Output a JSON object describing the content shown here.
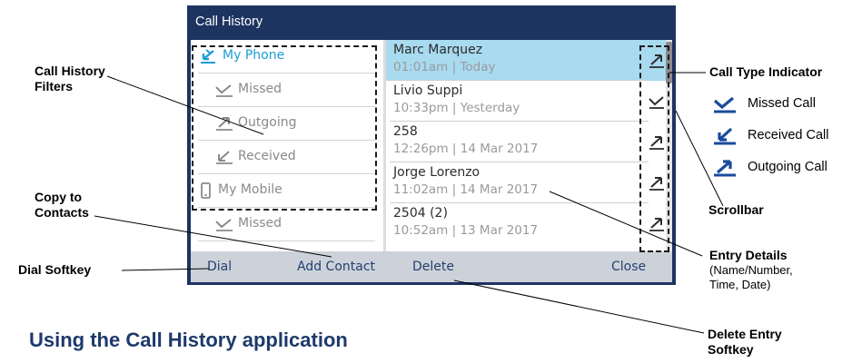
{
  "screen": {
    "title": "Call History",
    "filters": [
      {
        "label": "My Phone",
        "icon": "received-call-icon",
        "active": true
      },
      {
        "label": "Missed",
        "icon": "missed-call-icon",
        "active": false
      },
      {
        "label": "Outgoing",
        "icon": "outgoing-call-icon",
        "active": false
      },
      {
        "label": "Received",
        "icon": "received-call-icon",
        "active": false
      },
      {
        "label": "My Mobile",
        "icon": "mobile-phone-icon",
        "active": false
      },
      {
        "label": "Missed",
        "icon": "missed-call-icon",
        "active": false
      }
    ],
    "entries": [
      {
        "name": "Marc Marquez",
        "detail": "01:01am | Today",
        "type": "outgoing",
        "selected": true
      },
      {
        "name": "Livio Suppi",
        "detail": "10:33pm | Yesterday",
        "type": "missed",
        "selected": false
      },
      {
        "name": "258",
        "detail": "12:26pm | 14 Mar 2017",
        "type": "outgoing",
        "selected": false
      },
      {
        "name": "Jorge Lorenzo",
        "detail": "11:02am | 14 Mar 2017",
        "type": "outgoing",
        "selected": false
      },
      {
        "name": "2504 (2)",
        "detail": "10:52am | 13 Mar 2017",
        "type": "outgoing",
        "selected": false
      }
    ],
    "softkeys": {
      "dial": "Dial",
      "add_contact": "Add Contact",
      "delete": "Delete",
      "close": "Close"
    }
  },
  "callouts": {
    "filters_line1": "Call History",
    "filters_line2": "Filters",
    "copy_line1": "Copy to",
    "copy_line2": "Contacts",
    "dial_softkey": "Dial Softkey",
    "call_type_indicator": "Call Type Indicator",
    "scrollbar": "Scrollbar",
    "entry_details": "Entry Details",
    "entry_details_sub1": "(Name/Number,",
    "entry_details_sub2": "Time, Date)",
    "delete_line1": "Delete Entry",
    "delete_line2": "Softkey"
  },
  "legend": [
    {
      "label": "Missed Call",
      "icon": "missed-call-icon"
    },
    {
      "label": "Received Call",
      "icon": "received-call-icon"
    },
    {
      "label": "Outgoing Call",
      "icon": "outgoing-call-icon"
    }
  ],
  "heading": "Using the Call History application",
  "colors": {
    "title_bar": "#1d3461",
    "accent": "#1b9dd6",
    "selected_row": "#a8daf0",
    "softkey_bar": "#cdd2da",
    "heading": "#1d3a6b"
  }
}
